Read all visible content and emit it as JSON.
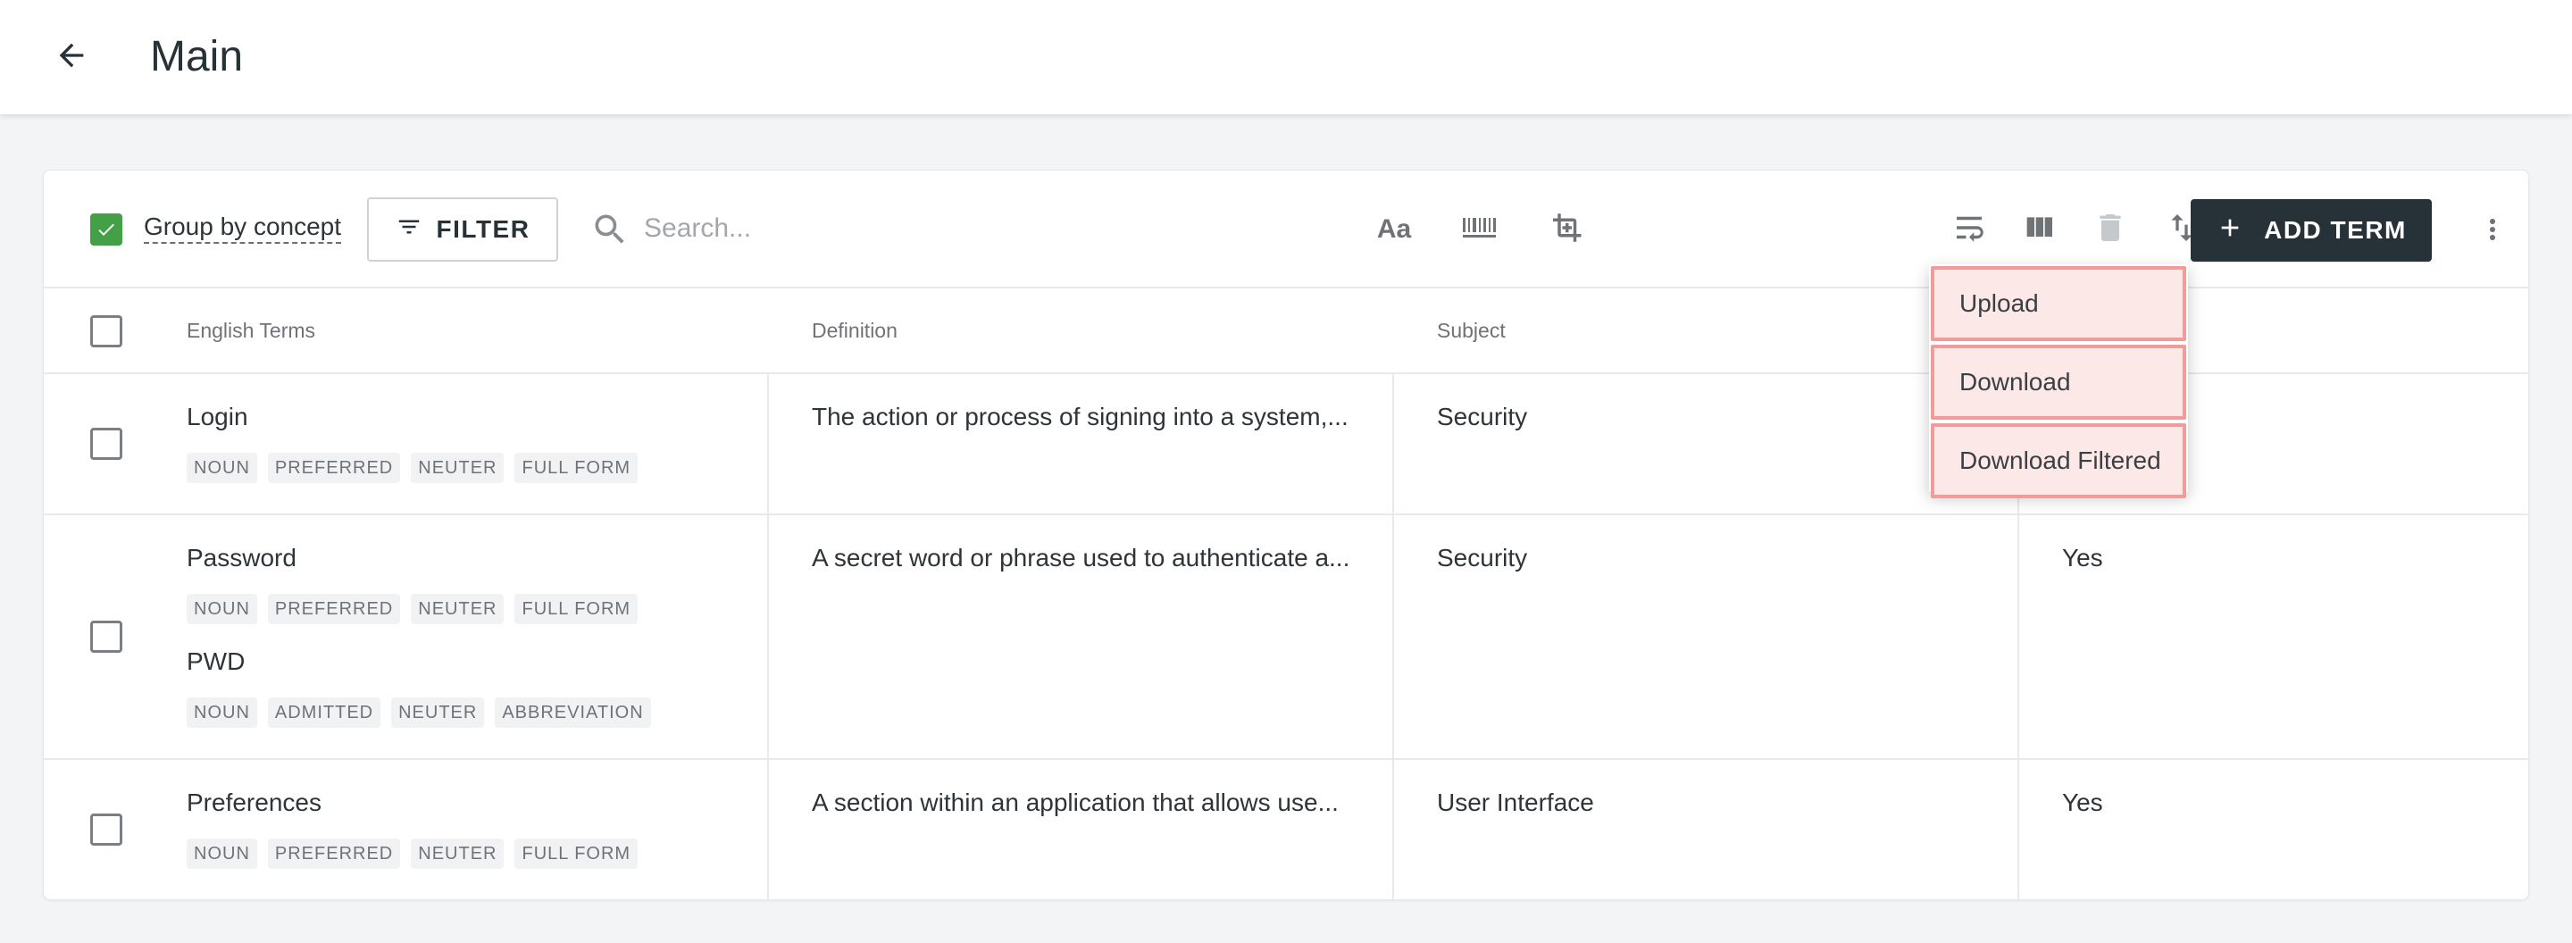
{
  "header": {
    "title": "Main",
    "back_icon": "arrow-left-icon"
  },
  "toolbar": {
    "group_by_concept": {
      "label": "Group by concept",
      "checked": true
    },
    "filter_label": "FILTER",
    "search_placeholder": "Search...",
    "text_case_label": "Aa",
    "tool_icons": [
      "text-case-icon",
      "barcode-icon",
      "crop-frame-icon",
      "wrap-text-icon",
      "columns-icon",
      "trash-icon",
      "sort-arrows-icon"
    ],
    "add_term_label": "ADD TERM",
    "more_icon": "more-vertical-icon"
  },
  "table": {
    "columns": [
      "English Terms",
      "Definition",
      "Subject",
      ""
    ],
    "rows": [
      {
        "terms": [
          {
            "term": "Login",
            "tags": [
              "NOUN",
              "PREFERRED",
              "NEUTER",
              "FULL FORM"
            ]
          }
        ],
        "definition": "The action or process of signing into a system,...",
        "subject": "Security",
        "extra": ""
      },
      {
        "terms": [
          {
            "term": "Password",
            "tags": [
              "NOUN",
              "PREFERRED",
              "NEUTER",
              "FULL FORM"
            ]
          },
          {
            "term": "PWD",
            "tags": [
              "NOUN",
              "ADMITTED",
              "NEUTER",
              "ABBREVIATION"
            ]
          }
        ],
        "definition": "A secret word or phrase used to authenticate a...",
        "subject": "Security",
        "extra": "Yes"
      },
      {
        "terms": [
          {
            "term": "Preferences",
            "tags": [
              "NOUN",
              "PREFERRED",
              "NEUTER",
              "FULL FORM"
            ]
          }
        ],
        "definition": "A section within an application that allows use...",
        "subject": "User Interface",
        "extra": "Yes"
      }
    ]
  },
  "dropdown_menu": {
    "items": [
      "Upload",
      "Download",
      "Download Filtered"
    ]
  },
  "colors": {
    "accent_dark": "#263238",
    "checkbox_checked": "#43a047",
    "menu_highlight_bg": "#fde8e8",
    "menu_highlight_border": "#f19b9b"
  }
}
